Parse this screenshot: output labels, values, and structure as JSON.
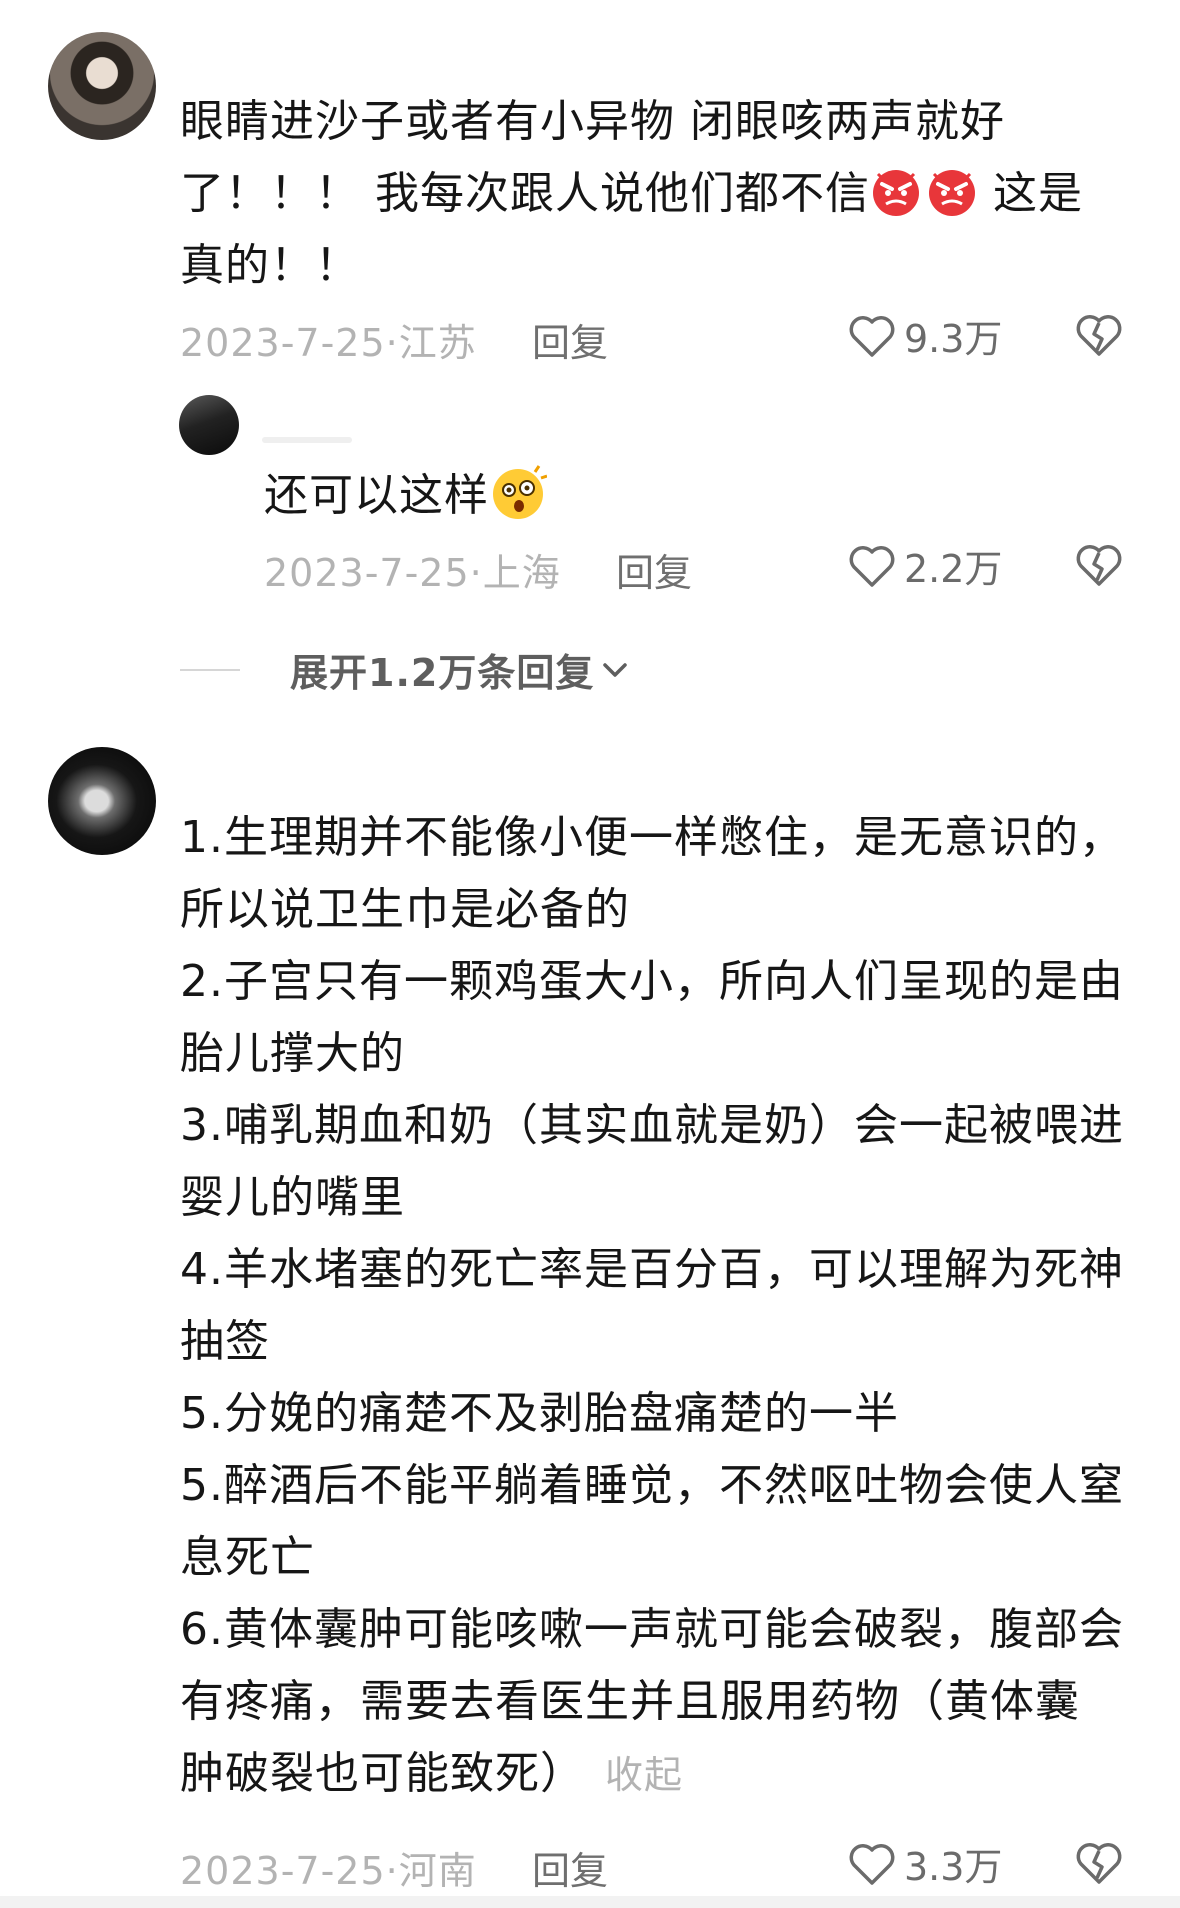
{
  "comments": [
    {
      "lines": [
        "眼睛进沙子或者有小异物 闭眼咳两声就好",
        "了！！！ 我每次跟人说他们都不信",
        " 这是",
        "真的！！"
      ],
      "date_location": "2023-7-25·江苏",
      "reply_label": "回复",
      "likes": "9.3万",
      "emoji": "angry-face"
    },
    {
      "text": "还可以这样",
      "date_location": "2023-7-25·上海",
      "reply_label": "回复",
      "likes": "2.2万",
      "emoji": "astonished-face"
    },
    {
      "lines": [
        "1.生理期并不能像小便一样憋住，是无意识的，",
        "所以说卫生巾是必备的",
        "2.子宫只有一颗鸡蛋大小，所向人们呈现的是由",
        "胎儿撑大的",
        "3.哺乳期血和奶（其实血就是奶）会一起被喂进",
        "婴儿的嘴里",
        "4.羊水堵塞的死亡率是百分百，可以理解为死神",
        "抽签",
        "5.分娩的痛楚不及剥胎盘痛楚的一半",
        "5.醉酒后不能平躺着睡觉，不然呕吐物会使人窒",
        "息死亡",
        "6.黄体囊肿可能咳嗽一声就可能会破裂，腹部会",
        "有疼痛，需要去看医生并且服用药物（黄体囊",
        "肿破裂也可能致死）"
      ],
      "collapse_label": "收起",
      "date_location": "2023-7-25·河南",
      "reply_label": "回复",
      "likes": "3.3万"
    }
  ],
  "expand_replies": "展开1.2万条回复",
  "icons": {
    "like": "heart-outline-icon",
    "dislike": "broken-heart-icon",
    "expand": "chevron-down-icon"
  },
  "colors": {
    "text": "#161616",
    "meta": "#b3b3b3",
    "action": "#6b6b6b"
  }
}
